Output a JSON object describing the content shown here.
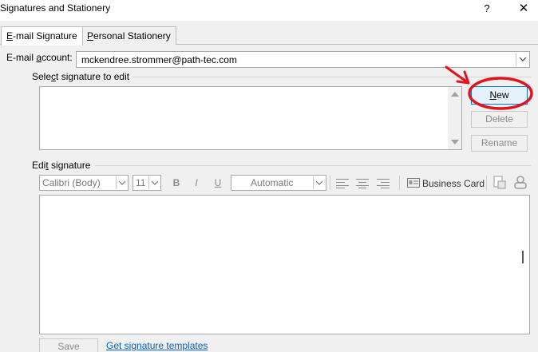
{
  "window": {
    "title": "Signatures and Stationery",
    "help_glyph": "?",
    "close_glyph": "✕"
  },
  "tabs": [
    {
      "label_u": "E",
      "label_rest": "-mail Signature",
      "active": true
    },
    {
      "label_u": "P",
      "label_rest": "ersonal Stationery",
      "active": false
    }
  ],
  "account": {
    "label_pre": "E-mail ",
    "label_u": "a",
    "label_post": "ccount:",
    "value": "mckendree.strommer@path-tec.com"
  },
  "select_signature": {
    "label_pre": "Sele",
    "label_u": "c",
    "label_post": "t signature to edit",
    "items": []
  },
  "buttons": {
    "new_u": "N",
    "new_rest": "ew",
    "delete": "Delete",
    "rename": "Rename",
    "save": "Save"
  },
  "edit_signature": {
    "label_pre": "Edi",
    "label_u": "t",
    "label_post": " signature"
  },
  "toolbar": {
    "font": "Calibri (Body)",
    "size": "11",
    "bold": "B",
    "italic": "I",
    "underline": "U",
    "color": "Automatic",
    "business_card": "Business Card"
  },
  "links": {
    "templates": "Get signature templates"
  },
  "colors": {
    "annotation": "#e0141e",
    "link": "#0563c1",
    "primary_border": "#0078d7"
  }
}
